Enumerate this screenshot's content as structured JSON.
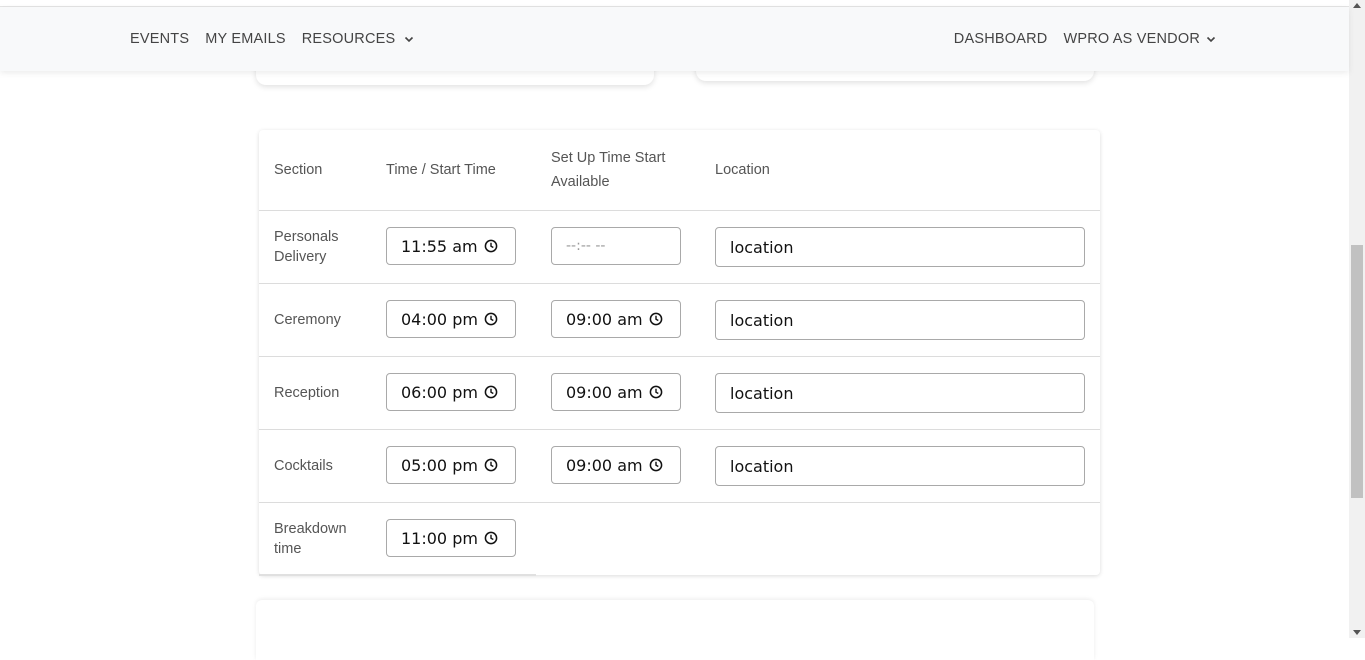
{
  "nav": {
    "left": [
      {
        "label": "EVENTS"
      },
      {
        "label": "MY EMAILS"
      },
      {
        "label": "RESOURCES",
        "dropdown": true
      }
    ],
    "right": [
      {
        "label": "DASHBOARD"
      },
      {
        "label": "WPRO AS VENDOR",
        "dropdown": true
      }
    ]
  },
  "table": {
    "headers": {
      "section": "Section",
      "time": "Time / Start Time",
      "setup_line1": "Set Up Time Start",
      "setup_line2": "Available",
      "location": "Location"
    },
    "rows": [
      {
        "section_l1": "Personals",
        "section_l2": "Delivery",
        "time": "11:55 am",
        "setup": "--:-- --",
        "location": "location"
      },
      {
        "section_l1": "Ceremony",
        "time": "04:00 pm",
        "setup": "09:00 am",
        "location": "location"
      },
      {
        "section_l1": "Reception",
        "time": "06:00 pm",
        "setup": "09:00 am",
        "location": "location"
      },
      {
        "section_l1": "Cocktails",
        "time": "05:00 pm",
        "setup": "09:00 am",
        "location": "location"
      },
      {
        "section_l1": "Breakdown",
        "section_l2": "time",
        "time": "11:00 pm"
      }
    ]
  },
  "icons": {
    "clock": "clock-icon",
    "chevron": "chevron-down-icon"
  },
  "colors": {
    "navbar_bg": "#f8f9fa",
    "border": "#a9a9a9",
    "text": "#555555"
  }
}
